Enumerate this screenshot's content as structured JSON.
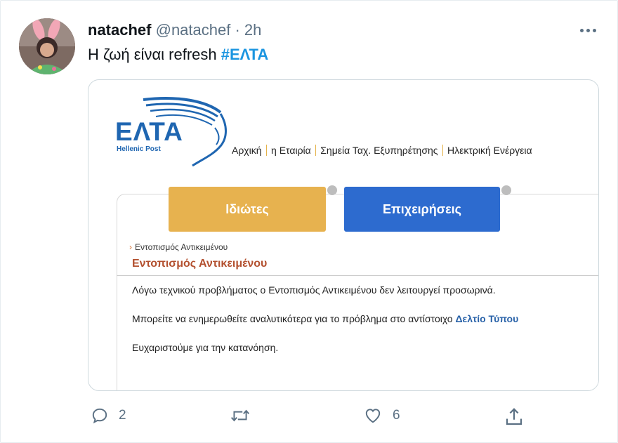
{
  "tweet": {
    "display_name": "natachef",
    "handle": "@natachef",
    "separator": "·",
    "time": "2h",
    "text": "Η ζωή είναι refresh",
    "hashtag": "#ΕΛΤΑ"
  },
  "media": {
    "logo_text": "ΕΛΤΑ",
    "logo_subtitle": "Hellenic Post",
    "nav": [
      "Αρχική",
      "η Εταιρία",
      "Σημεία Ταχ. Εξυπηρέτησης",
      "Ηλεκτρική Ενέργεια"
    ],
    "tabs": {
      "private": "Ιδιώτες",
      "business": "Επιχειρήσεις"
    },
    "breadcrumb": "Εντοπισμός Αντικειμένου",
    "heading": "Εντοπισμός Αντικειμένου",
    "message_1": "Λόγω τεχνικού προβλήματος ο Εντοπισμός Αντικειμένου δεν λειτουργεί προσωρινά.",
    "message_2": "Μπορείτε να ενημερωθείτε αναλυτικότερα για το πρόβλημα στο αντίστοιχο",
    "message_2_link": "Δελτίο Τύπου",
    "message_3": "Ευχαριστούμε για την κατανόηση.",
    "colors": {
      "brand_blue": "#1f66b1",
      "tab_yellow": "#e7b24f",
      "tab_blue": "#2d6bcf",
      "heading": "#b3502f"
    }
  },
  "actions": {
    "reply_count": "2",
    "retweet_count": "",
    "like_count": "6",
    "icons": [
      "reply-icon",
      "retweet-icon",
      "like-icon",
      "share-icon"
    ]
  },
  "colors": {
    "hashtag": "#1b95e0",
    "secondary_text": "#5b7083"
  }
}
